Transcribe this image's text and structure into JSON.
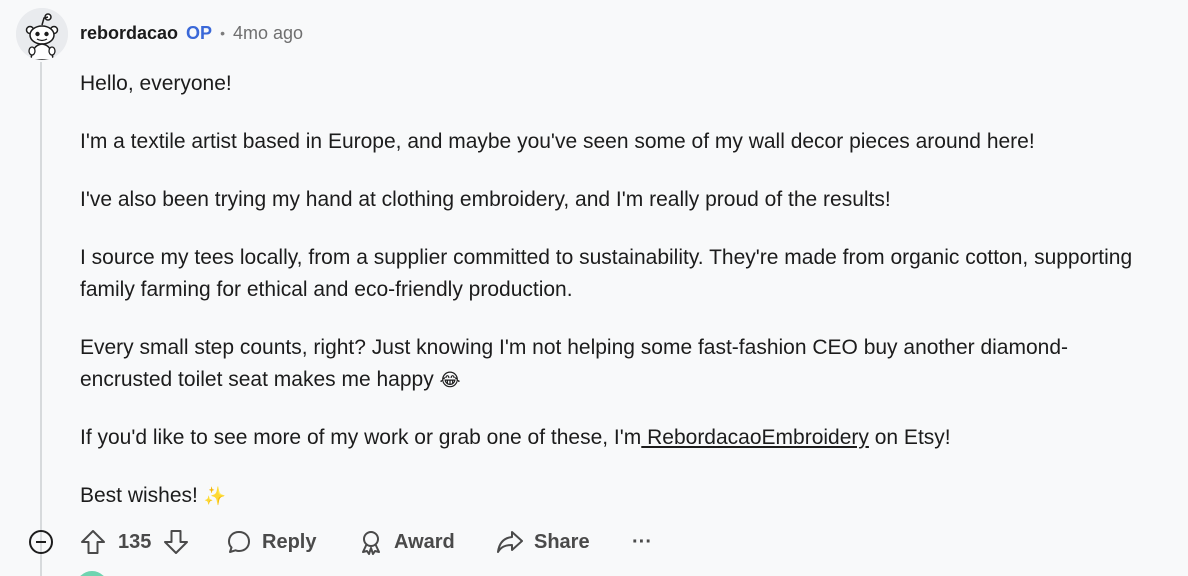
{
  "comment": {
    "author": "rebordacao",
    "op_badge": "OP",
    "separator": "•",
    "timestamp": "4mo ago",
    "paragraphs": {
      "p1": "Hello, everyone!",
      "p2": "I'm a textile artist based in Europe, and maybe you've seen some of my wall decor pieces around here!",
      "p3": "I've also been trying my hand at clothing embroidery, and I'm really proud of the results!",
      "p4": "I source my tees locally, from a supplier committed to sustainability. They're made from organic cotton, supporting family farming for ethical and eco-friendly production.",
      "p5": "Every small step counts, right? Just knowing I'm not helping some fast-fashion CEO buy another diamond-encrusted toilet seat makes me happy",
      "p5_emoji": "😂",
      "p6_before": "If you'd like to see more of my work or grab one of these, I'm",
      "p6_link": " RebordacaoEmbroidery",
      "p6_after": " on Etsy!",
      "p7": "Best wishes!",
      "p7_emoji": "✨"
    }
  },
  "actions": {
    "vote_count": "135",
    "reply_label": "Reply",
    "award_label": "Award",
    "share_label": "Share",
    "more_label": "···"
  },
  "icons": {
    "avatar": "snoo-avatar-icon",
    "collapse": "collapse-minus-icon",
    "upvote": "upvote-arrow-icon",
    "downvote": "downvote-arrow-icon",
    "reply": "speech-bubble-icon",
    "award": "award-ribbon-icon",
    "share": "share-arrow-icon"
  },
  "colors": {
    "op_badge": "#3a68d8",
    "background": "#f8f9fa",
    "action_text": "#4a4a4a",
    "thread_line": "#d7dadc"
  }
}
